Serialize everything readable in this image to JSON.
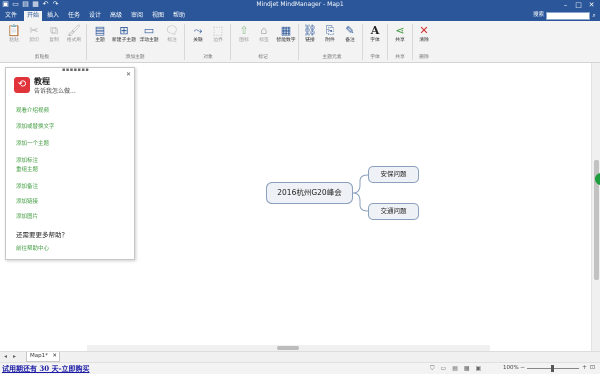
{
  "titlebar": {
    "title": "Mindjet MindManager - Map1",
    "qat_icons": [
      "app-icon",
      "new-icon",
      "open-icon",
      "save-icon",
      "undo-icon",
      "redo-icon"
    ],
    "min": "–",
    "max": "□",
    "close": "✕"
  },
  "menu": {
    "tabs": [
      "文件",
      "开始",
      "插入",
      "任务",
      "设计",
      "高级",
      "审阅",
      "视图",
      "帮助"
    ],
    "active": "开始",
    "search_label": "搜索",
    "search_placeholder": ""
  },
  "ribbon": {
    "buttons": {
      "paste": "粘贴",
      "cut": "剪切",
      "copy": "复制",
      "format_painter": "格式刷",
      "topic": "主题",
      "subtopic": "新建子主题",
      "float_topic": "浮动主题",
      "callout": "标注",
      "relationship": "关联",
      "boundary": "边界",
      "priority": "图标",
      "tags": "标签",
      "numbering": "智能数字",
      "link": "链接",
      "attachment": "附件",
      "notes": "备注",
      "text": "字体",
      "share": "共享",
      "delete": "清除"
    },
    "groups": {
      "clipboard": "剪贴板",
      "add_topic": "添加主题",
      "objects": "对象",
      "markers": "标记",
      "topic_elements": "主题元素",
      "font": "字体",
      "share": "共享",
      "delete": "删除"
    }
  },
  "panel": {
    "title": "教程",
    "subtitle": "告诉我怎么做...",
    "links": [
      "观看介绍视频",
      "添加或替换文字",
      "添加一个主题",
      "添加标注",
      "重组主题",
      "添加备注",
      "添加链接",
      "添加图片"
    ],
    "help_heading": "还需要更多帮助？",
    "help_link": "前往帮助中心"
  },
  "map": {
    "central": "2016杭州G20峰会",
    "subtopics": [
      "安保问题",
      "交通问题"
    ],
    "node_fill": "#eef1f6",
    "node_border": "#8aa0bc"
  },
  "doc_tabs": {
    "active": "Map1*",
    "close": "✕"
  },
  "statusbar": {
    "trial": "试用期还有 30 天-立即购买",
    "zoom": "100%"
  },
  "colors": {
    "accent": "#2b579a",
    "link_green": "#3d9a3d",
    "panel_logo": "#e0343a"
  }
}
